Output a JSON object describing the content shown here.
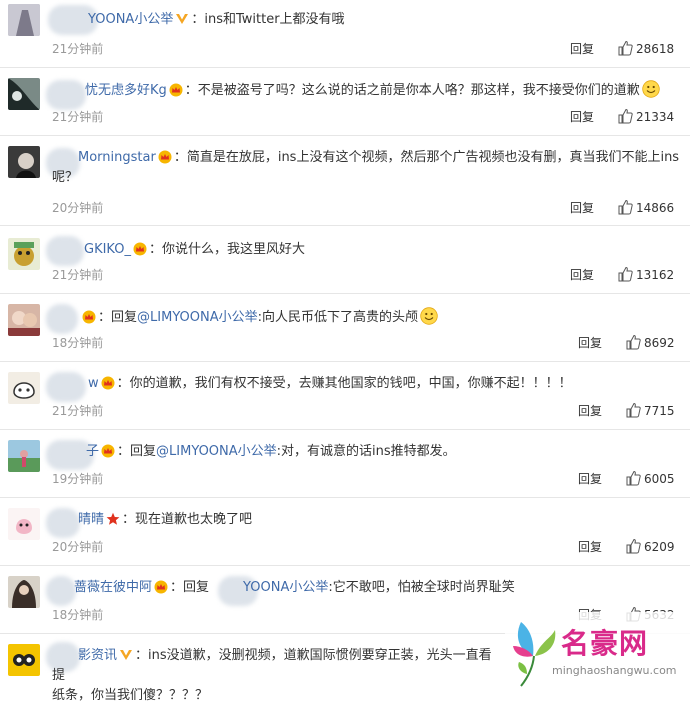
{
  "reply_label": "回复",
  "comments": [
    {
      "name": "YOONA小公举",
      "badge": "v",
      "pre": "",
      "mention": "",
      "text": "ins和Twitter上都没有哦",
      "line2": "",
      "emoji": false,
      "time": "21分钟前",
      "likes": "28618"
    },
    {
      "name": "忧无虑多好Kg",
      "badge": "crown",
      "pre": "",
      "mention": "",
      "text": "不是被盗号了吗？这么说的话之前是你本人咯？那这样，我不接受你们的道歉",
      "line2": "",
      "emoji": true,
      "time": "21分钟前",
      "likes": "21334"
    },
    {
      "name": "Morningstar",
      "badge": "crown",
      "pre": "",
      "mention": "",
      "text": "简直是在放屁，ins上没有这个视频，然后那个广告视频也没有删，真当我们不能上ins",
      "line2": "呢？",
      "emoji": false,
      "time": "20分钟前",
      "likes": "14866"
    },
    {
      "name": "GKIKO_",
      "badge": "crown",
      "pre": "",
      "mention": "",
      "text": "你说什么，我这里风好大",
      "line2": "",
      "emoji": false,
      "time": "21分钟前",
      "likes": "13162"
    },
    {
      "name": "",
      "badge": "crown",
      "pre": "回复",
      "mention": "@LIMYOONA小公举",
      "text": ":向人民币低下了高贵的头颅",
      "line2": "",
      "emoji": true,
      "time": "18分钟前",
      "likes": "8692"
    },
    {
      "name": "w",
      "badge": "crown",
      "pre": "",
      "mention": "",
      "text": "你的道歉，我们有权不接受，去赚其他国家的钱吧，中国，你赚不起！！！！",
      "line2": "",
      "emoji": false,
      "time": "21分钟前",
      "likes": "7715"
    },
    {
      "name": "子",
      "badge": "crown",
      "pre": "回复",
      "mention": "@LIMYOONA小公举",
      "text": ":对，有诚意的话ins推特都发。",
      "line2": "",
      "emoji": false,
      "time": "19分钟前",
      "likes": "6005"
    },
    {
      "name": "晴晴",
      "badge": "star",
      "pre": "",
      "mention": "",
      "text": "现在道歉也太晚了吧",
      "line2": "",
      "emoji": false,
      "time": "20分钟前",
      "likes": "6209"
    },
    {
      "name": "蔷薇在彼中阿",
      "badge": "crown",
      "pre": "回复",
      "mention": "YOONA小公举",
      "text": ":它不敢吧，怕被全球时尚界耻笑",
      "line2": "",
      "emoji": false,
      "time": "18分钟前",
      "likes": "5632"
    },
    {
      "name": "影资讯",
      "badge": "v",
      "pre": "",
      "mention": "",
      "text": "ins没道歉，没删视频，道歉国际惯例要穿正装，光头一直看提",
      "line2": "纸条，你当我们傻？？？？",
      "emoji": false,
      "time": "",
      "likes": ""
    }
  ],
  "watermark": {
    "title": "名豪网",
    "url": "minghaoshangwu.com"
  }
}
